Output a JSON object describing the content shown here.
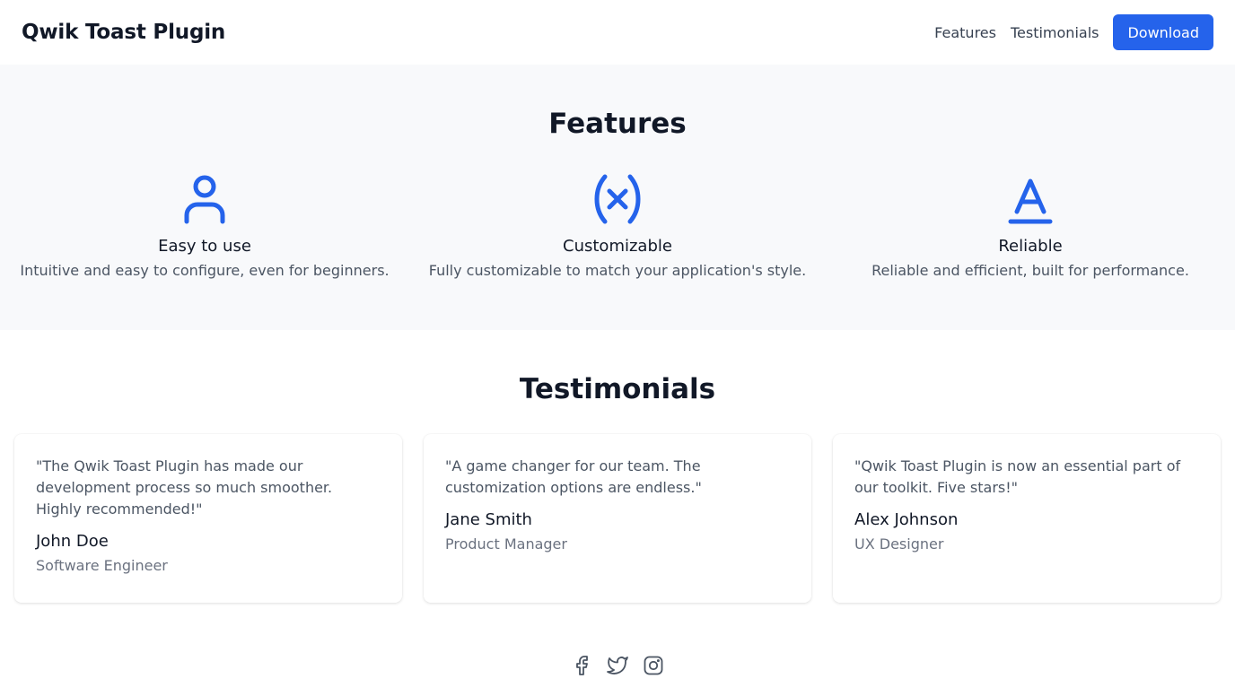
{
  "header": {
    "brand": "Qwik Toast Plugin",
    "nav": [
      {
        "label": "Features"
      },
      {
        "label": "Testimonials"
      }
    ],
    "download_label": "Download"
  },
  "features": {
    "title": "Features",
    "items": [
      {
        "icon": "user-icon",
        "title": "Easy to use",
        "description": "Intuitive and easy to configure, even for beginners."
      },
      {
        "icon": "variable-x-icon",
        "title": "Customizable",
        "description": "Fully customizable to match your application's style."
      },
      {
        "icon": "text-a-underline-icon",
        "title": "Reliable",
        "description": "Reliable and efficient, built for performance."
      }
    ]
  },
  "testimonials": {
    "title": "Testimonials",
    "items": [
      {
        "quote": "\"The Qwik Toast Plugin has made our development process so much smoother. Highly recommended!\"",
        "name": "John Doe",
        "role": "Software Engineer"
      },
      {
        "quote": "\"A game changer for our team. The customization options are endless.\"",
        "name": "Jane Smith",
        "role": "Product Manager"
      },
      {
        "quote": "\"Qwik Toast Plugin is now an essential part of our toolkit. Five stars!\"",
        "name": "Alex Johnson",
        "role": "UX Designer"
      }
    ]
  },
  "footer": {
    "social": [
      "facebook-icon",
      "twitter-icon",
      "instagram-icon"
    ]
  },
  "colors": {
    "accent": "#2563eb",
    "section_bg": "#f8f9fb",
    "icon_gray": "#4b5563"
  }
}
